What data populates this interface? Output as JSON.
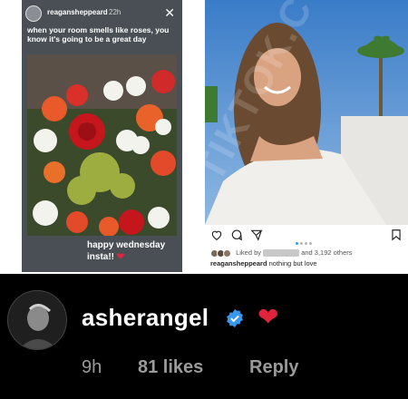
{
  "story": {
    "username": "reagansheppeard",
    "time": "22h",
    "caption": "when your room smells like roses, you know it's going to be a great day",
    "bottom_text": "happy wednesday insta!! ",
    "heart": "❤"
  },
  "post": {
    "carousel_dots": 4,
    "likes_prefix": "Liked by ",
    "likes_suffix": " and 3,192 others",
    "caption_user": "reagansheppeard",
    "caption_text": "nothing but love"
  },
  "comment": {
    "username": "asherangel",
    "heart": "❤",
    "time": "9h",
    "likes": "81 likes",
    "reply": "Reply"
  },
  "watermark": "TIKTOK.COM",
  "colors": {
    "heart": "#e0243b",
    "verified": "#3897f0",
    "comment_bg": "#000000",
    "meta_text": "#9a9a9a"
  }
}
